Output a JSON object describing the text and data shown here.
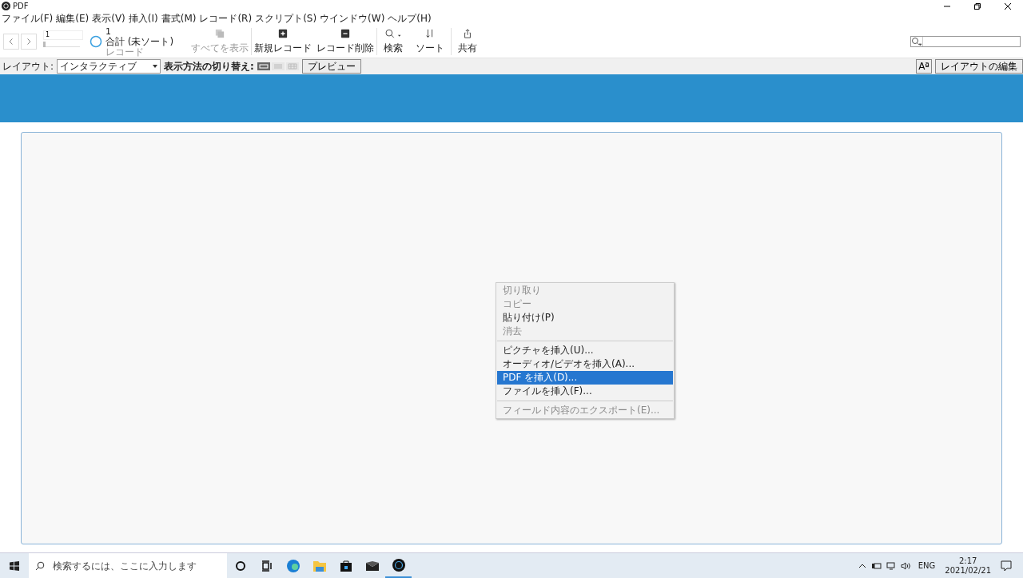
{
  "window": {
    "title": "PDF"
  },
  "menu": [
    "ファイル(F)",
    "編集(E)",
    "表示(V)",
    "挿入(I)",
    "書式(M)",
    "レコード(R)",
    "スクリプト(S)",
    "ウインドウ(W)",
    "ヘルプ(H)"
  ],
  "toolbar": {
    "record_field": "1",
    "slider": {
      "level": 0
    },
    "count": "1",
    "total": "合計 (未ソート)",
    "records_label": "レコード",
    "buttons": [
      {
        "kind": "showall",
        "label": "すべてを表示",
        "disabled": true
      },
      {
        "kind": "new",
        "label": "新規レコード",
        "disabled": false
      },
      {
        "kind": "delete",
        "label": "レコード削除",
        "disabled": false
      },
      {
        "kind": "search",
        "label": "検索",
        "disabled": false
      },
      {
        "kind": "sort",
        "label": "ソート",
        "disabled": false
      },
      {
        "kind": "share",
        "label": "共有",
        "disabled": false
      }
    ]
  },
  "layout_bar": {
    "layout_label": "レイアウト:",
    "layout_value": "インタラクティブ",
    "view_label": "表示方法の切り替え:",
    "views": [
      {
        "selected": true
      },
      {
        "selected": false
      },
      {
        "selected": false
      }
    ],
    "preview": "プレビュー",
    "font_button": "Aª",
    "edit_layout": "レイアウトの編集"
  },
  "context_menu": [
    {
      "kind": "item",
      "label": "切り取り",
      "disabled": true,
      "selected": false
    },
    {
      "kind": "item",
      "label": "コピー",
      "disabled": true,
      "selected": false
    },
    {
      "kind": "item",
      "label": "貼り付け(P)",
      "disabled": false,
      "selected": false
    },
    {
      "kind": "item",
      "label": "消去",
      "disabled": true,
      "selected": false
    },
    {
      "kind": "separator"
    },
    {
      "kind": "item",
      "label": "ピクチャを挿入(U)...",
      "disabled": false,
      "selected": false
    },
    {
      "kind": "item",
      "label": "オーディオ/ビデオを挿入(A)...",
      "disabled": false,
      "selected": false
    },
    {
      "kind": "item",
      "label": "PDF を挿入(D)...",
      "disabled": false,
      "selected": true
    },
    {
      "kind": "item",
      "label": "ファイルを挿入(F)...",
      "disabled": false,
      "selected": false
    },
    {
      "kind": "separator"
    },
    {
      "kind": "item",
      "label": "フィールド内容のエクスポート(E)...",
      "disabled": true,
      "selected": false
    }
  ],
  "taskbar": {
    "search_placeholder": "検索するには、ここに入力します",
    "apps": [
      {
        "kind": "cortana",
        "selected": false
      },
      {
        "kind": "taskview",
        "selected": false
      },
      {
        "kind": "edge",
        "selected": false
      },
      {
        "kind": "folder",
        "selected": false
      },
      {
        "kind": "store",
        "selected": false
      },
      {
        "kind": "mail",
        "selected": false
      },
      {
        "kind": "app",
        "selected": true
      }
    ],
    "language": "ENG",
    "time": "2:17",
    "date": "2021/02/21"
  }
}
